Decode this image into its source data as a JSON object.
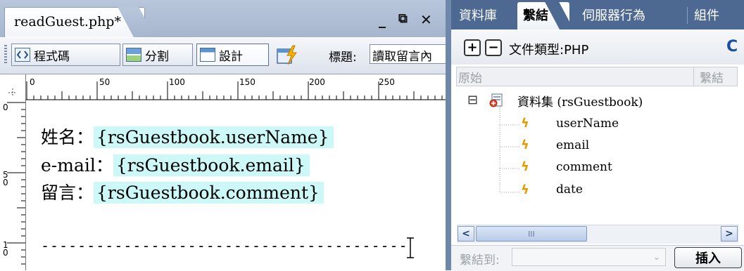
{
  "document": {
    "tab_title": "readGuest.php*",
    "window_buttons": {
      "minimize": "_",
      "restore": "⧉",
      "close": "✕"
    },
    "toolbar": {
      "code_label": "程式碼",
      "split_label": "分割",
      "design_label": "設計",
      "title_label": "標題:",
      "title_value": "讀取留言內"
    },
    "ruler": {
      "h_marks": [
        "0",
        "50",
        "100",
        "150",
        "200",
        "250"
      ],
      "v_marks": [
        "0",
        "5\n0",
        "1\n0"
      ]
    },
    "content": {
      "rows": [
        {
          "label": "姓名：",
          "binding": "{rsGuestbook.userName}"
        },
        {
          "label": "e-mail：",
          "binding": "{rsGuestbook.email}"
        },
        {
          "label": "留言：",
          "binding": "{rsGuestbook.comment}"
        }
      ],
      "separator": "----------------------------------------"
    }
  },
  "panel": {
    "tabs": [
      "資料庫",
      "繫結",
      "伺服器行為",
      "組件"
    ],
    "active_tab": "繫結",
    "add_label": "+",
    "remove_label": "−",
    "doc_type": "文件類型:PHP",
    "refresh_icon": "C",
    "columns": {
      "source": "原始",
      "binding": "繫結"
    },
    "tree": {
      "expander": "⊟",
      "recordset_label": "資料集 (rsGuestbook)",
      "fields": [
        "userName",
        "email",
        "comment",
        "date"
      ]
    },
    "scroll": {
      "left": "<",
      "right": ">",
      "thumb": "III"
    },
    "bind_to_label": "繫結到:",
    "select_arrow": "⌄",
    "insert_label": "插入"
  },
  "colors": {
    "bound_highlight": "#ccf8f8",
    "panel_tabbar": "#4e6991",
    "bolt": "#e79a00"
  }
}
